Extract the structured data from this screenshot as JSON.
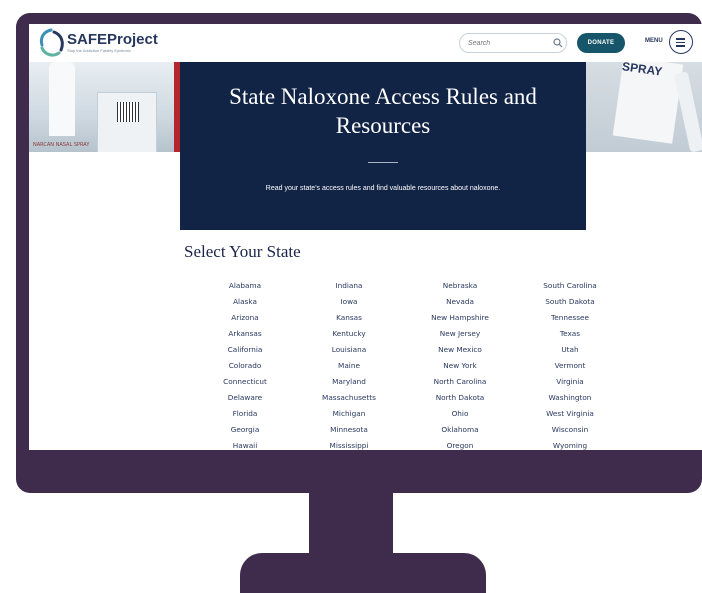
{
  "header": {
    "logo_text": "SAFEProject",
    "logo_tagline": "Stop the Addiction Fatality Epidemic",
    "search_placeholder": "Search",
    "donate_label": "DONATE",
    "menu_label": "MENU"
  },
  "hero": {
    "title": "State Naloxone Access Rules and Resources",
    "subtitle": "Read your state's access rules and find valuable resources about naloxone.",
    "left_image_label": "NARCAN NASAL SPRAY",
    "right_image_title": "SPRAY"
  },
  "states_section": {
    "title": "Select Your State",
    "columns": [
      [
        "Alabama",
        "Alaska",
        "Arizona",
        "Arkansas",
        "California",
        "Colorado",
        "Connecticut",
        "Delaware",
        "Florida",
        "Georgia",
        "Hawaii"
      ],
      [
        "Indiana",
        "Iowa",
        "Kansas",
        "Kentucky",
        "Louisiana",
        "Maine",
        "Maryland",
        "Massachusetts",
        "Michigan",
        "Minnesota",
        "Mississippi"
      ],
      [
        "Nebraska",
        "Nevada",
        "New Hampshire",
        "New Jersey",
        "New Mexico",
        "New York",
        "North Carolina",
        "North Dakota",
        "Ohio",
        "Oklahoma",
        "Oregon"
      ],
      [
        "South Carolina",
        "South Dakota",
        "Tennessee",
        "Texas",
        "Utah",
        "Vermont",
        "Virginia",
        "Washington",
        "West Virginia",
        "Wisconsin",
        "Wyoming"
      ]
    ]
  },
  "colors": {
    "hero_bg": "#122446",
    "donate_bg": "#17566a",
    "monitor_frame": "#3f2c4d",
    "accent_red": "#b3262d"
  }
}
